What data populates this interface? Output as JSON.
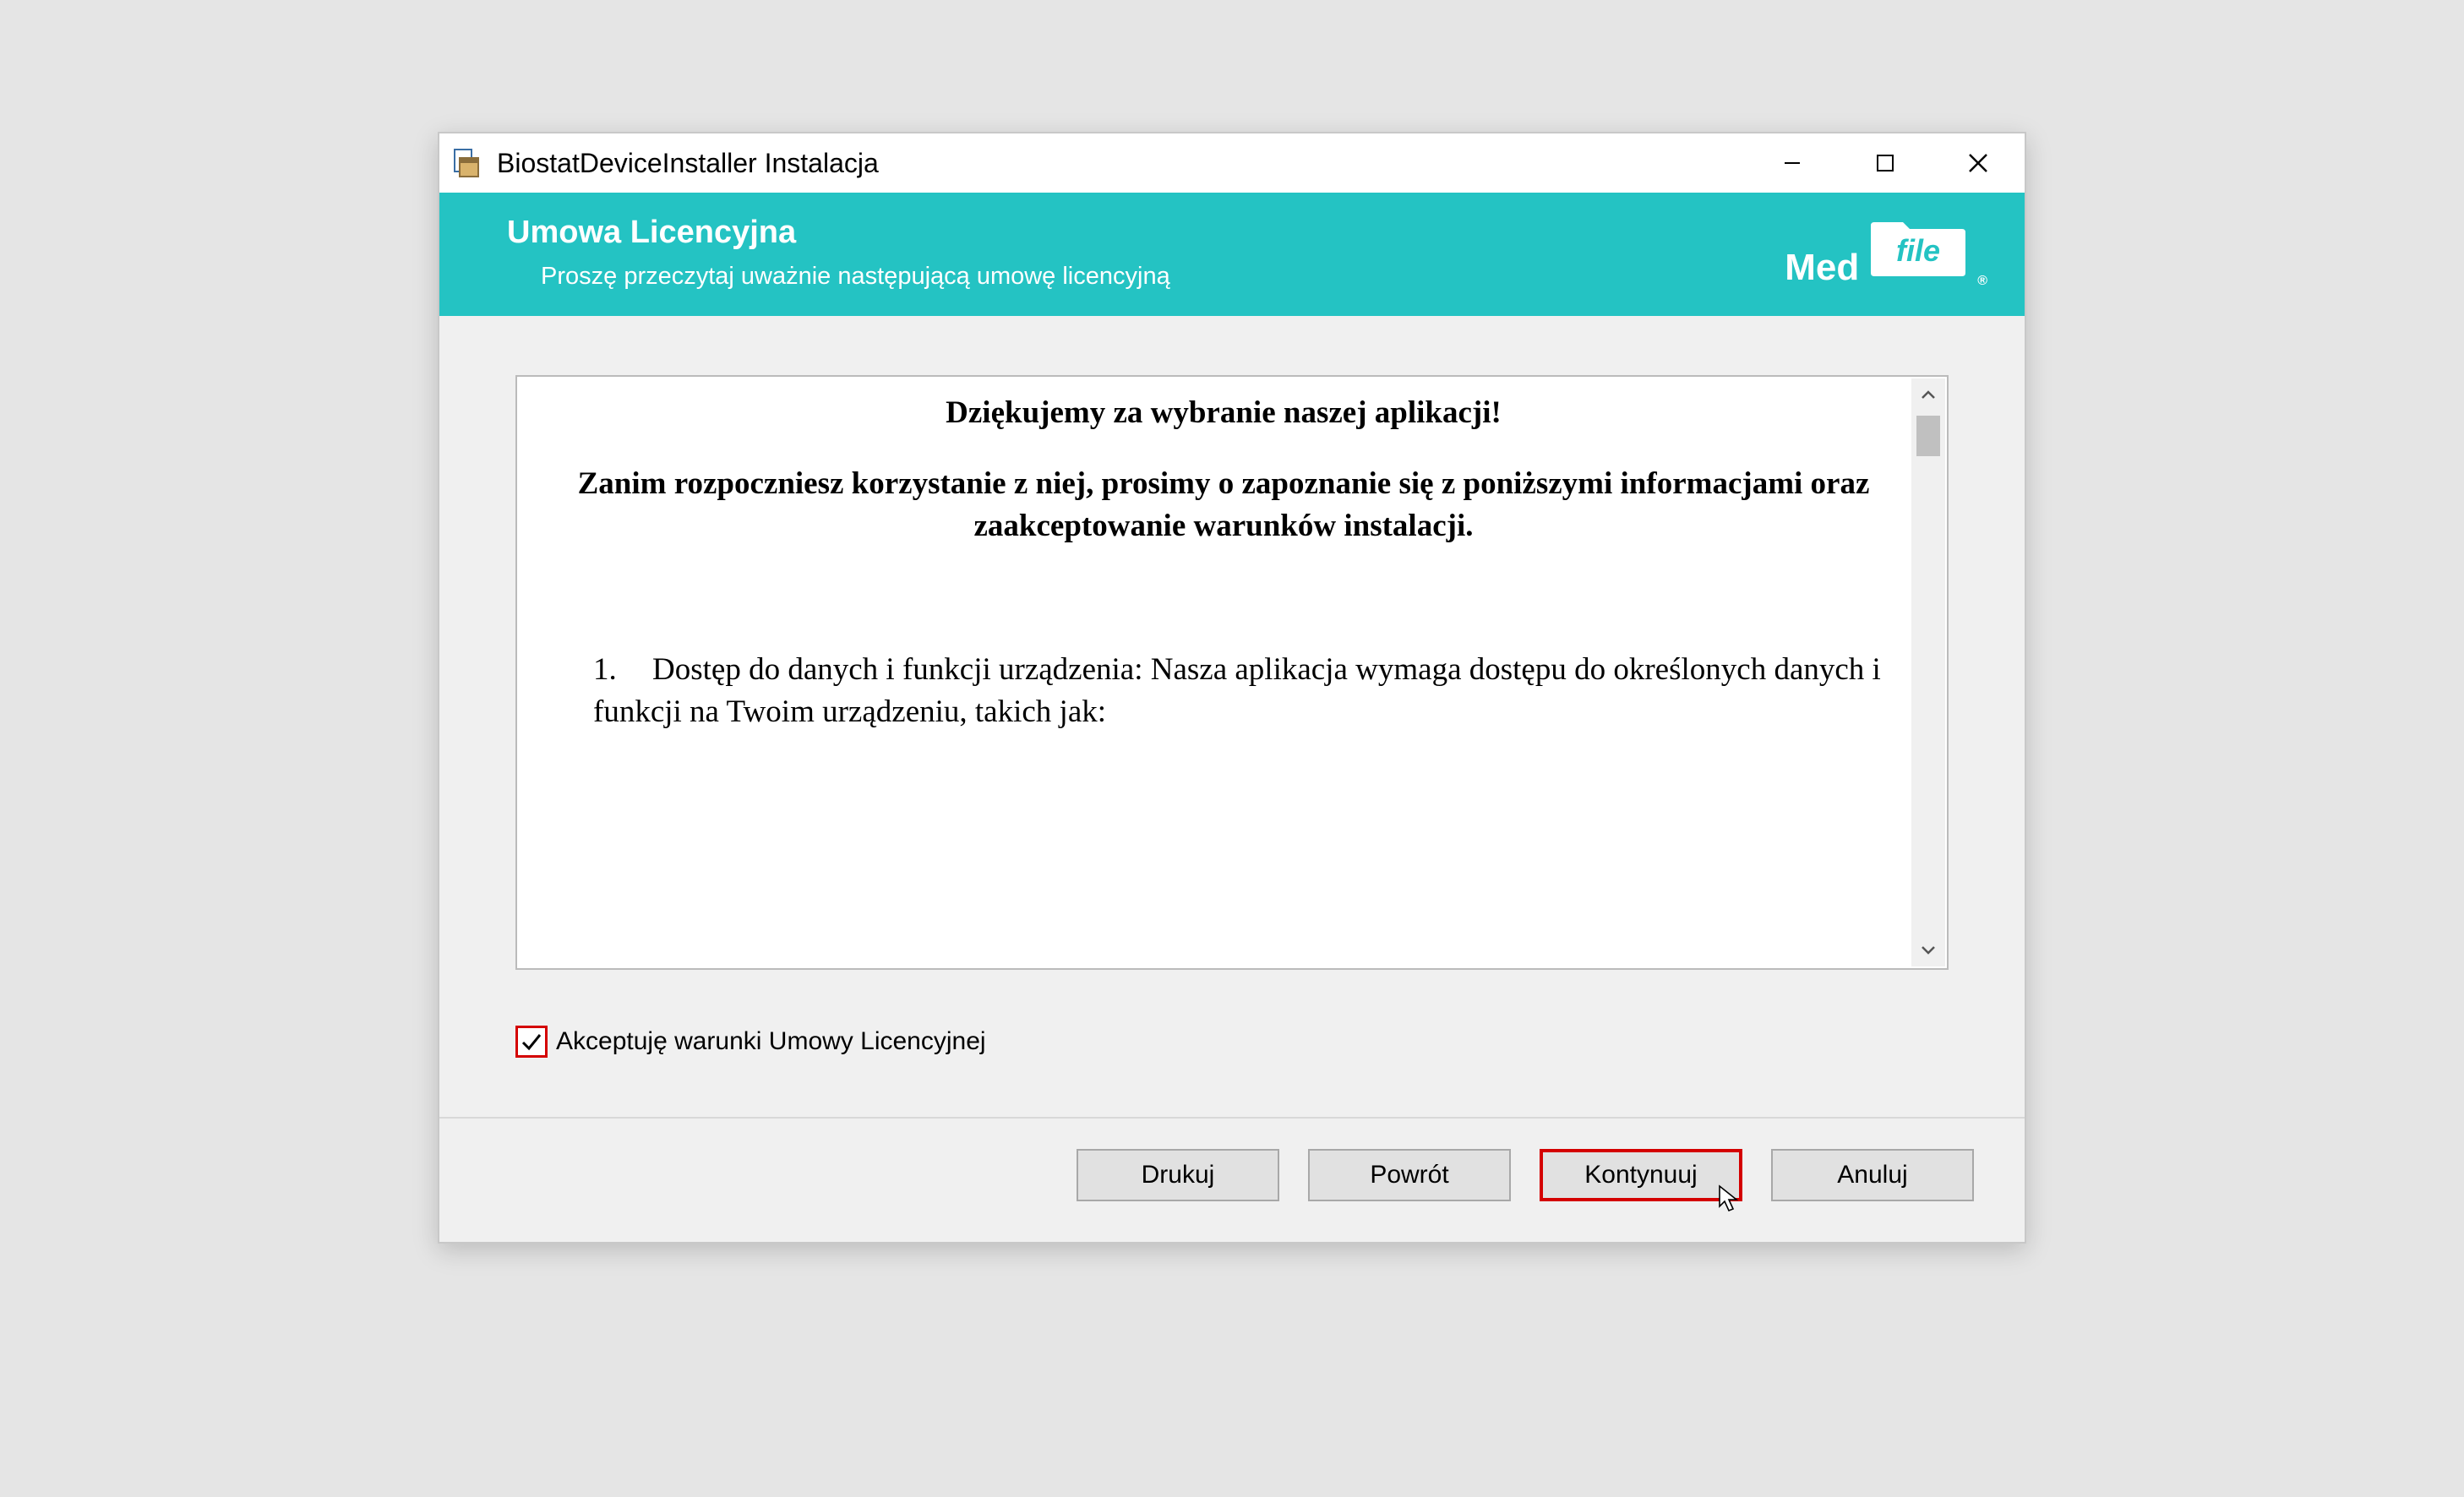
{
  "window": {
    "title": "BiostatDeviceInstaller Instalacja"
  },
  "header": {
    "title": "Umowa Licencyjna",
    "subtitle": "Proszę przeczytaj uważnie następującą umowę licencyjną",
    "brand_prefix": "Med",
    "brand_box": "file"
  },
  "license": {
    "thanks": "Dziękujemy za wybranie naszej aplikacji!",
    "intro": "Zanim rozpoczniesz korzystanie z niej, prosimy o zapoznanie się z poniższymi informacjami oraz zaakceptowanie warunków instalacji.",
    "item1_num": "1.",
    "item1_text": "Dostęp do danych i funkcji urządzenia: Nasza aplikacja wymaga dostępu do określonych danych i funkcji na Twoim urządzeniu, takich jak:"
  },
  "accept": {
    "label": "Akceptuję warunki Umowy Licencyjnej",
    "checked": true
  },
  "buttons": {
    "print": "Drukuj",
    "back": "Powrót",
    "continue": "Kontynuuj",
    "cancel": "Anuluj"
  }
}
